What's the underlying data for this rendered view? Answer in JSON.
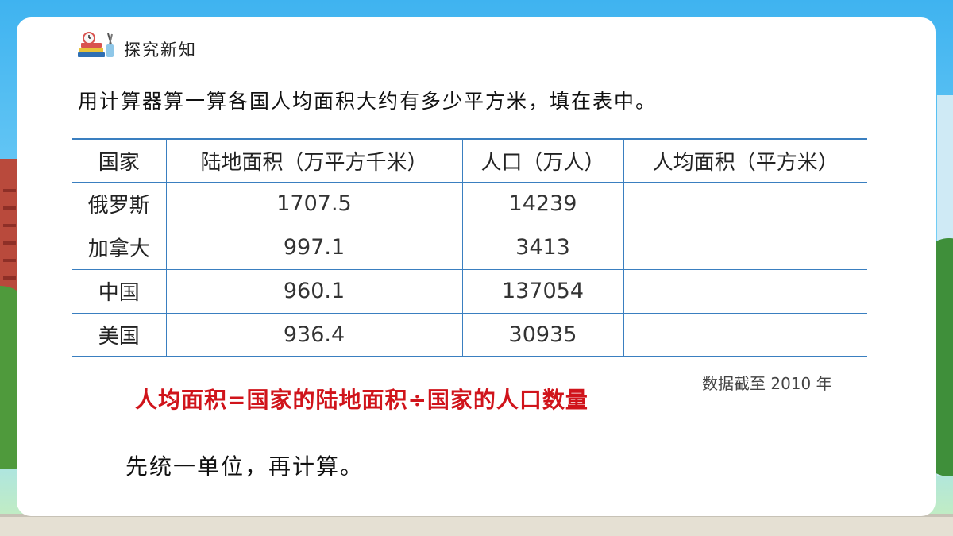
{
  "header": {
    "icon": "books-clock-icon",
    "title": "探究新知"
  },
  "instruction": "用计算器算一算各国人均面积大约有多少平方米，填在表中。",
  "table": {
    "headers": [
      "国家",
      "陆地面积（万平方千米）",
      "人口（万人）",
      "人均面积（平方米）"
    ],
    "rows": [
      [
        "俄罗斯",
        "1707.5",
        "14239",
        ""
      ],
      [
        "加拿大",
        "997.1",
        "3413",
        ""
      ],
      [
        "中国",
        "960.1",
        "137054",
        ""
      ],
      [
        "美国",
        "936.4",
        "30935",
        ""
      ]
    ]
  },
  "source_note": "数据截至 2010 年",
  "formula": "人均面积=国家的陆地面积÷国家的人口数量",
  "hint": "先统一单位，再计算。",
  "colors": {
    "table_border": "#3a7fc0",
    "formula": "#d0141b",
    "background_sky": "#3fb3f0"
  }
}
